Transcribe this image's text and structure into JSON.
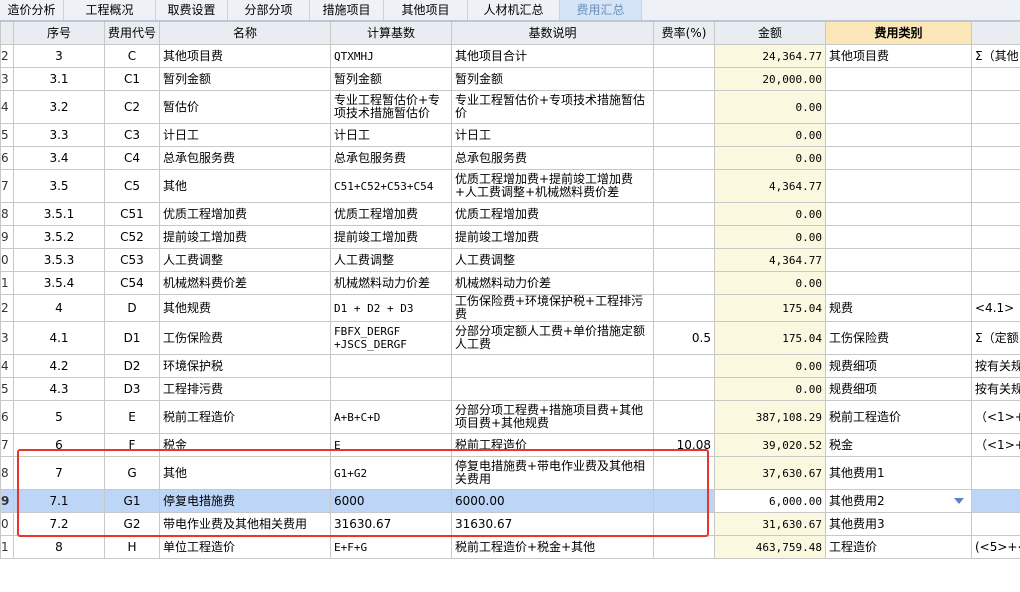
{
  "tabs": [
    {
      "label": "造价分析",
      "active": false
    },
    {
      "label": "工程概况",
      "active": false
    },
    {
      "label": "取费设置",
      "active": false
    },
    {
      "label": "分部分项",
      "active": false
    },
    {
      "label": "措施项目",
      "active": false
    },
    {
      "label": "其他项目",
      "active": false
    },
    {
      "label": "人材机汇总",
      "active": false
    },
    {
      "label": "费用汇总",
      "active": true
    }
  ],
  "columns": [
    "序号",
    "费用代号",
    "名称",
    "计算基数",
    "基数说明",
    "费率(%)",
    "金额",
    "费用类别",
    ""
  ],
  "rows": [
    {
      "rn": "2",
      "seq": "3",
      "code": "C",
      "name": "其他项目费",
      "base": "QTXMHJ",
      "desc": "其他项目合计",
      "rate": "",
      "amount": "24,364.77",
      "cat": "其他项目费",
      "extra": "Σ（其他"
    },
    {
      "rn": "3",
      "seq": "3.1",
      "code": "C1",
      "name": "暂列金额",
      "base": "暂列金额",
      "desc": "暂列金额",
      "rate": "",
      "amount": "20,000.00",
      "cat": "",
      "extra": ""
    },
    {
      "rn": "4",
      "seq": "3.2",
      "code": "C2",
      "name": "暂估价",
      "base": "专业工程暂估价+专项技术措施暂估价",
      "desc": "专业工程暂估价+专项技术措施暂估价",
      "rate": "",
      "amount": "0.00",
      "cat": "",
      "extra": ""
    },
    {
      "rn": "5",
      "seq": "3.3",
      "code": "C3",
      "name": "计日工",
      "base": "计日工",
      "desc": "计日工",
      "rate": "",
      "amount": "0.00",
      "cat": "",
      "extra": ""
    },
    {
      "rn": "6",
      "seq": "3.4",
      "code": "C4",
      "name": "总承包服务费",
      "base": "总承包服务费",
      "desc": "总承包服务费",
      "rate": "",
      "amount": "0.00",
      "cat": "",
      "extra": ""
    },
    {
      "rn": "7",
      "seq": "3.5",
      "code": "C5",
      "name": "其他",
      "base": "C51+C52+C53+C54",
      "desc": "优质工程增加费+提前竣工增加费+人工费调整+机械燃料费价差",
      "rate": "",
      "amount": "4,364.77",
      "cat": "",
      "extra": ""
    },
    {
      "rn": "8",
      "seq": "3.5.1",
      "code": "C51",
      "name": "优质工程增加费",
      "base": "优质工程增加费",
      "desc": "优质工程增加费",
      "rate": "",
      "amount": "0.00",
      "cat": "",
      "extra": ""
    },
    {
      "rn": "9",
      "seq": "3.5.2",
      "code": "C52",
      "name": "提前竣工增加费",
      "base": "提前竣工增加费",
      "desc": "提前竣工增加费",
      "rate": "",
      "amount": "0.00",
      "cat": "",
      "extra": ""
    },
    {
      "rn": "0",
      "seq": "3.5.3",
      "code": "C53",
      "name": "人工费调整",
      "base": "人工费调整",
      "desc": "人工费调整",
      "rate": "",
      "amount": "4,364.77",
      "cat": "",
      "extra": ""
    },
    {
      "rn": "1",
      "seq": "3.5.4",
      "code": "C54",
      "name": "机械燃料费价差",
      "base": "机械燃料动力价差",
      "desc": "机械燃料动力价差",
      "rate": "",
      "amount": "0.00",
      "cat": "",
      "extra": ""
    },
    {
      "rn": "2",
      "seq": "4",
      "code": "D",
      "name": "其他规费",
      "base": "D1 + D2 + D3",
      "desc": "工伤保险费+环境保护税+工程排污费",
      "rate": "",
      "amount": "175.04",
      "cat": "规费",
      "extra": "<4.1>"
    },
    {
      "rn": "3",
      "seq": "4.1",
      "code": "D1",
      "name": "工伤保险费",
      "base": "FBFX_DERGF +JSCS_DERGF",
      "desc": "分部分项定额人工费+单价措施定额人工费",
      "rate": "0.5",
      "amount": "175.04",
      "cat": "工伤保险费",
      "extra": "Σ（定额"
    },
    {
      "rn": "4",
      "seq": "4.2",
      "code": "D2",
      "name": "环境保护税",
      "base": "",
      "desc": "",
      "rate": "",
      "amount": "0.00",
      "cat": "规费细项",
      "extra": "按有关规"
    },
    {
      "rn": "5",
      "seq": "4.3",
      "code": "D3",
      "name": "工程排污费",
      "base": "",
      "desc": "",
      "rate": "",
      "amount": "0.00",
      "cat": "规费细项",
      "extra": "按有关规"
    },
    {
      "rn": "6",
      "seq": "5",
      "code": "E",
      "name": "税前工程造价",
      "base": "A+B+C+D",
      "desc": "分部分项工程费+措施项目费+其他项目费+其他规费",
      "rate": "",
      "amount": "387,108.29",
      "cat": "税前工程造价",
      "extra": "（<1>+<"
    },
    {
      "rn": "7",
      "seq": "6",
      "code": "F",
      "name": "税金",
      "base": "E",
      "desc": "税前工程造价",
      "rate": "10.08",
      "amount": "39,020.52",
      "cat": "税金",
      "extra": "（<1>+<"
    },
    {
      "rn": "8",
      "seq": "7",
      "code": "G",
      "name": "其他",
      "base": "G1+G2",
      "desc": "停复电措施费+带电作业费及其他相关费用",
      "rate": "",
      "amount": "37,630.67",
      "cat": "其他费用1",
      "extra": ""
    },
    {
      "rn": "9",
      "seq": "7.1",
      "code": "G1",
      "name": "停复电措施费",
      "base": "6000",
      "desc": "6000.00",
      "rate": "",
      "amount": "6,000.00",
      "cat": "其他费用2",
      "extra": "",
      "selected": true
    },
    {
      "rn": "0",
      "seq": "7.2",
      "code": "G2",
      "name": "带电作业费及其他相关费用",
      "base": "31630.67",
      "desc": "31630.67",
      "rate": "",
      "amount": "31,630.67",
      "cat": "其他费用3",
      "extra": ""
    },
    {
      "rn": "1",
      "seq": "8",
      "code": "H",
      "name": "单位工程造价",
      "base": "E+F+G",
      "desc": "税前工程造价+税金+其他",
      "rate": "",
      "amount": "463,759.48",
      "cat": "工程造价",
      "extra": "(<5>+<6"
    }
  ]
}
